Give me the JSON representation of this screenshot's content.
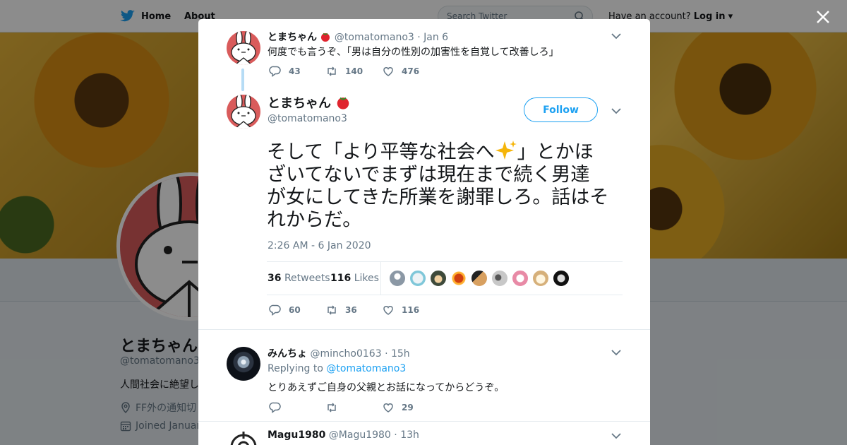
{
  "header": {
    "home_label": "Home",
    "about_label": "About",
    "search_placeholder": "Search Twitter",
    "account_prompt": "Have an account?",
    "login_label": "Log in"
  },
  "profile": {
    "name": "とまちゃん",
    "handle": "@tomatomano3",
    "bio": "人間社会に絶望し",
    "location": "FF外の通知切",
    "joined": "Joined Januar"
  },
  "tweets": [
    {
      "name": "とまちゃん",
      "handle": "@tomatomano3",
      "time": "· Jan 6",
      "text": "何度でも言うぞ、「男は自分の性別の加害性を自覚して改善しろ」",
      "replies": "43",
      "retweets": "140",
      "likes": "476"
    }
  ],
  "main_tweet": {
    "name": "とまちゃん",
    "handle": "@tomatomano3",
    "follow_label": "Follow",
    "text_lines": [
      "そして「より平等な社会へ",
      "」とかほ",
      "ざいてないでまずは現在まで続く男達",
      "が女にしてきた所業を謝罪しろ。話はそ",
      "れからだ。"
    ],
    "timestamp": "2:26 AM - 6 Jan 2020",
    "retweet_count": "36",
    "retweet_label": "Retweets",
    "like_count": "116",
    "like_label": "Likes",
    "replies": "60",
    "retweets": "36",
    "likes": "116"
  },
  "replies": [
    {
      "name": "みんちょ",
      "handle": "@mincho0163",
      "time": "· 15h",
      "replying_prefix": "Replying to",
      "replying_to": "@tomatomano3",
      "text": "とりあえずご自身の父親とお話になってからどうぞ。",
      "replies": "",
      "retweets": "",
      "likes": "29"
    },
    {
      "name": "Magu1980",
      "handle": "@Magu1980",
      "time": "· 13h"
    }
  ],
  "colors": {
    "accent": "#1da1f2",
    "text": "#14171a",
    "muted": "#657786",
    "border": "#e6ecf0"
  },
  "icons": [
    "twitter-bird-icon",
    "home-icon",
    "search-icon",
    "close-icon",
    "chevron-down-icon",
    "reply-icon",
    "retweet-icon",
    "like-icon",
    "location-icon",
    "calendar-icon",
    "sparkles-icon",
    "tomato-icon"
  ]
}
